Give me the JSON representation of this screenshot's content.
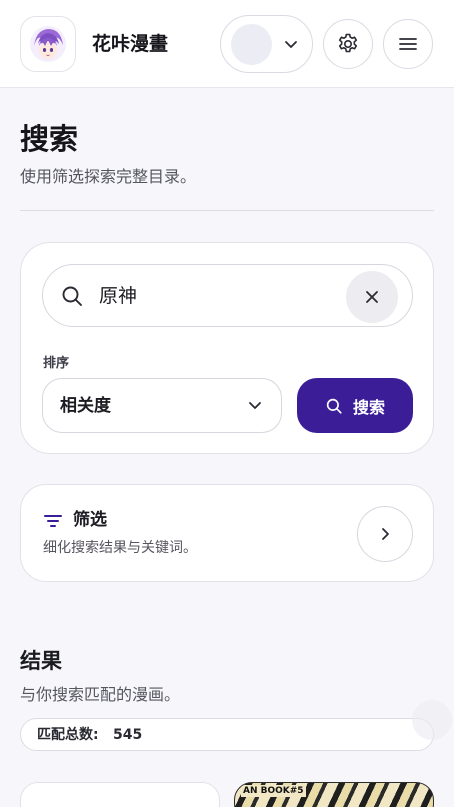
{
  "header": {
    "brand": "花咔漫畫",
    "logo_icon": "anime-avatar-logo",
    "account_icon": "user-avatar",
    "settings_icon": "gear-icon",
    "menu_icon": "hamburger-menu-icon"
  },
  "page": {
    "title": "搜索",
    "subtitle": "使用筛选探索完整目录。"
  },
  "search": {
    "query": "原神",
    "sort_label": "排序",
    "sort_value": "相关度",
    "button_label": "搜索"
  },
  "filters": {
    "title": "筛选",
    "subtitle": "细化搜索结果与关键词。"
  },
  "results": {
    "title": "结果",
    "subtitle": "与你搜索匹配的漫画。",
    "count_label": "匹配总数:",
    "count_value": "545",
    "cover_text": "AN BOOK#5"
  },
  "colors": {
    "accent": "#3a1d97",
    "background": "#f7f7fb",
    "card": "#ffffff",
    "text_muted": "#55555f"
  }
}
